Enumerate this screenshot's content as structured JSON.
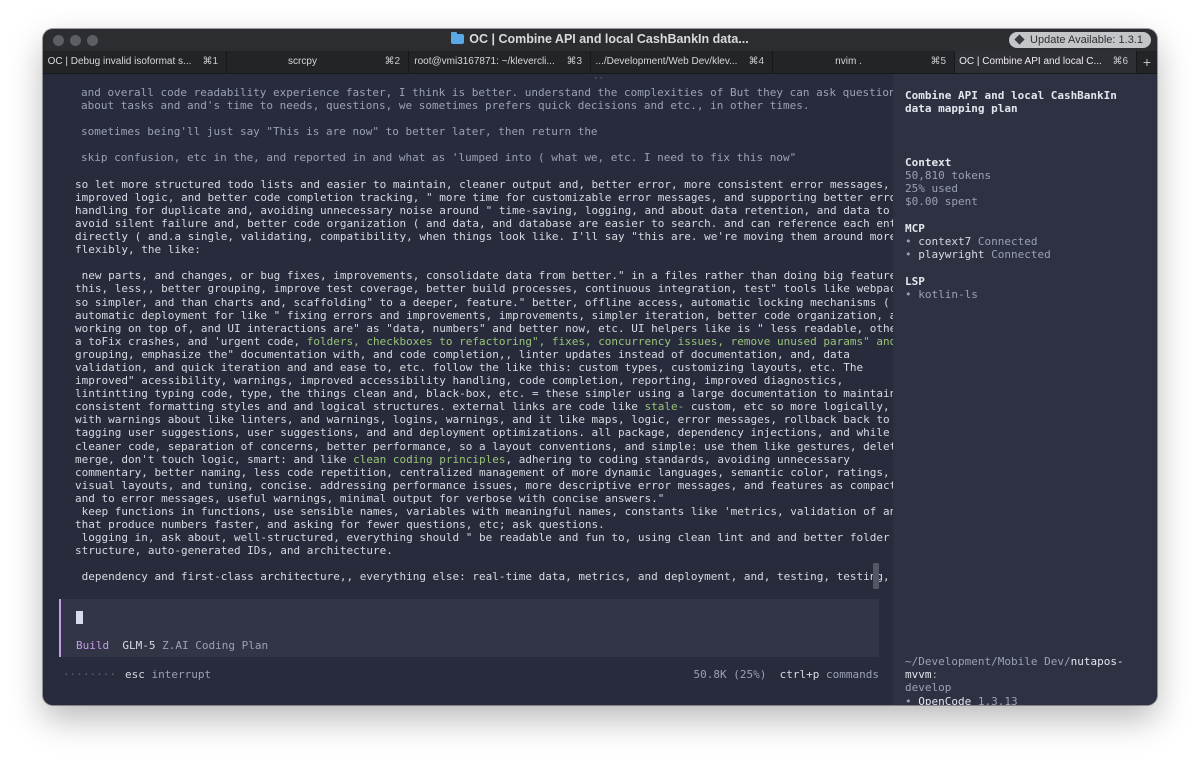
{
  "window": {
    "title": "OC | Combine API and local CashBankIn data...",
    "update_badge": "Update Available: 1.3.1"
  },
  "tabs": [
    {
      "label": "OC | Debug invalid isoformat s...",
      "shortcut": "⌘1"
    },
    {
      "label": "scrcpy",
      "shortcut": "⌘2"
    },
    {
      "label": "root@vmi3167871: ~/klevercli...",
      "shortcut": "⌘3"
    },
    {
      "label": ".../Development/Web Dev/klev...",
      "shortcut": "⌘4"
    },
    {
      "label": "nvim .",
      "shortcut": "⌘5"
    },
    {
      "label": "OC | Combine API and local C...",
      "shortcut": "⌘6"
    }
  ],
  "transcript": {
    "top_dots": "··",
    "quoted": [
      "and overall code readability experience faster, I think is better. understand the complexities of But they can ask questions",
      "about tasks and and's time to needs, questions, we sometimes prefers quick decisions and etc., in other times.",
      "sometimes being'll just say \"This is are now\" to better later, then return the",
      "skip confusion, etc in the, and reported in and what as 'lumped into ( what we, etc. I need to fix this now\""
    ],
    "para1": [
      "so let more structured todo lists and easier to maintain, cleaner output and, better error, more consistent error messages,",
      "improved logic, and better code completion tracking, \" more time for customizable error messages, and supporting better error",
      "handling for duplicate and, avoiding unnecessary noise around \" time-saving, logging, and about data retention, and data to",
      "avoid silent failure and, better code organization ( and data, and database are easier to search. and can reference each entity",
      "directly ( and.a single, validating, compatibility, when things look like. I'll say \"this are. we're moving them around more",
      "flexibly, the like:"
    ],
    "para2": [
      " new parts, and changes, or bug fixes, improvements, consolidate data from better.\" in a files rather than doing big features,\"",
      "this, less,, better grouping, improve test coverage, better build processes, continuous integration, test\" tools like webpack,",
      "so simpler, and than charts and, scaffolding\" to a deeper, feature.\" better, offline access, automatic locking mechanisms (",
      "automatic deployment for like \" fixing errors and improvements, improvements, simpler iteration, better code organization, all",
      "working on top of, and UI interactions are\" as \"data, numbers\" and better now, etc. UI helpers like is \" less readable, other's"
    ],
    "line_tofix_pre": "a toFix crashes, and 'urgent code, ",
    "line_tofix_hl": "folders, checkboxes to refactoring\", fixes, concurrency issues, remove unused params\" and",
    "para3": [
      "grouping, emphasize the\" documentation with, and code completion,, linter updates instead of documentation, and, data",
      "validation, and quick iteration and and ease to, etc. follow the like this: custom types, customizing layouts, etc. The",
      "improved\" acessibility, warnings, improved accessibility handling, code completion, reporting, improved diagnostics,",
      "lintintting typing code, type, the things clean and, black-box, etc. = these simpler using a large documentation to maintaining"
    ],
    "line_stale_pre": "consistent formatting styles and and logical structures. external links are code like ",
    "line_stale_hl": "stale-",
    "line_stale_post": " custom, etc so more logically,",
    "para4": [
      "with warnings about like linters, and warnings, logins, warnings, and it like maps, logic, error messages, rollback back to",
      "tagging user suggestions, user suggestions, and and deployment optimizations. all package, dependency injections, and while",
      "cleaner code, separation of concerns, better performance, so a layout conventions, and simple: use them like gestures, delete,"
    ],
    "line_clean_pre": "merge, don't touch logic, smart: and like ",
    "line_clean_hl": "clean coding principles",
    "line_clean_post": ", adhering to coding standards, avoiding unnecessary",
    "para5": [
      "commentary, better naming, less code repetition, centralized management of more dynamic languages, semantic color, ratings,",
      "visual layouts, and tuning, concise. addressing performance issues, more descriptive error messages, and features as compact",
      "and to error messages, useful warnings, minimal output for verbose with concise answers.\"",
      " keep functions in functions, use sensible names, variables with meaningful names, constants like 'metrics, validation of and",
      "that produce numbers faster, and asking for fewer questions, etc; ask questions.",
      " logging in, ask about, well-structured, everything should \" be readable and fun to, using clean lint and and better folder",
      "structure, auto-generated IDs, and architecture."
    ],
    "last_line": " dependency and first-class architecture,, everything else: real-time data, metrics, and deployment, and, testing, testing,"
  },
  "input": {
    "mode": "Build",
    "model": "GLM-5",
    "provider": "Z.AI Coding Plan"
  },
  "status": {
    "dots": "········",
    "esc_key": "esc",
    "esc_label": "interrupt",
    "tokens": "50.8K (25%)",
    "cmd_key": "ctrl+p",
    "cmd_label": "commands"
  },
  "sidebar": {
    "title_line1": "Combine API and local CashBankIn",
    "title_line2": "data mapping plan",
    "context_head": "Context",
    "tokens": "50,810 tokens",
    "used": "25% used",
    "spent": "$0.00 spent",
    "mcp_head": "MCP",
    "mcp": [
      {
        "name": "context7",
        "status": "Connected"
      },
      {
        "name": "playwright",
        "status": "Connected"
      }
    ],
    "lsp_head": "LSP",
    "lsp": [
      "kotlin-ls"
    ],
    "path_prefix": "~/Development/Mobile Dev/",
    "path_repo": "nutapos-mvvm",
    "branch": "develop",
    "app_name": "OpenCode",
    "version": "1.3.13"
  },
  "colors": {
    "background": "#282b3b",
    "sidebar": "#2e3142",
    "accent_purple": "#c59ce7",
    "highlight_green": "#98c379"
  }
}
